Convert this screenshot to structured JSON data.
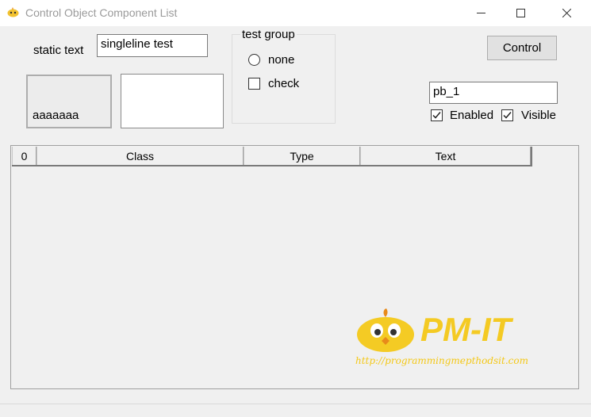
{
  "window": {
    "title": "Control Object Component List",
    "minimize_glyph": "minimize-icon",
    "maximize_glyph": "maximize-icon",
    "close_glyph": "close-icon"
  },
  "form": {
    "static_label": "static text",
    "singleline_value": "singleline test",
    "picture_caption": "aaaaaaa",
    "multiline_value": "",
    "group": {
      "caption": "test group",
      "radio_label": "none",
      "radio_checked": false,
      "check_label": "check",
      "check_checked": false
    },
    "control_button": "Control",
    "name_field_value": "pb_1",
    "enabled_label": "Enabled",
    "enabled_checked": true,
    "visible_label": "Visible",
    "visible_checked": true
  },
  "table": {
    "columns": [
      "0",
      "Class",
      "Type",
      "Text"
    ],
    "rows": []
  },
  "watermark": {
    "brand": "PM-IT",
    "url": "http://programmingmepthodsit.com",
    "color": "#f5c400"
  }
}
